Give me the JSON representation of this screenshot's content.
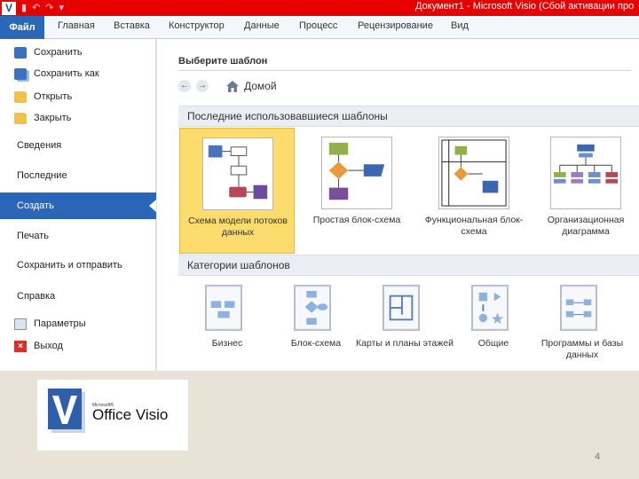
{
  "window": {
    "app_letter": "V",
    "title": "Документ1  -  Microsoft Visio (Сбой активации про"
  },
  "ribbon": {
    "tabs": [
      "Файл",
      "Главная",
      "Вставка",
      "Конструктор",
      "Данные",
      "Процесс",
      "Рецензирование",
      "Вид"
    ]
  },
  "backstage_menu": {
    "items": [
      {
        "label": "Сохранить",
        "icon": "save-icon"
      },
      {
        "label": "Сохранить как",
        "icon": "save-as-icon"
      },
      {
        "label": "Открыть",
        "icon": "open-folder-icon"
      },
      {
        "label": "Закрыть",
        "icon": "close-folder-icon"
      },
      {
        "label": "Сведения"
      },
      {
        "label": "Последние"
      },
      {
        "label": "Создать",
        "active": true
      },
      {
        "label": "Печать"
      },
      {
        "label": "Сохранить и отправить"
      },
      {
        "label": "Справка"
      },
      {
        "label": "Параметры",
        "icon": "options-icon"
      },
      {
        "label": "Выход",
        "icon": "exit-icon"
      }
    ]
  },
  "main": {
    "heading": "Выберите шаблон",
    "nav": {
      "back": "←",
      "forward": "→",
      "location": "Домой"
    },
    "recent_header": "Последние использовавшиеся шаблоны",
    "recent": [
      {
        "label": "Схема модели потоков данных",
        "selected": true
      },
      {
        "label": "Простая блок-схема"
      },
      {
        "label": "Функциональная блок-схема"
      },
      {
        "label": "Организационная диаграмма"
      }
    ],
    "categories_header": "Категории шаблонов",
    "categories": [
      {
        "label": "Бизнес"
      },
      {
        "label": "Блок-схема"
      },
      {
        "label": "Карты и планы этажей"
      },
      {
        "label": "Общие"
      },
      {
        "label": "Программы и базы данных"
      }
    ]
  },
  "logo": {
    "small": "Microsoft®",
    "name": "Office Visio"
  },
  "slide": {
    "page_number": "4"
  },
  "colors": {
    "title_bar": "#e60000",
    "file_tab": "#2a67b9",
    "selection": "#fbdc6d"
  }
}
